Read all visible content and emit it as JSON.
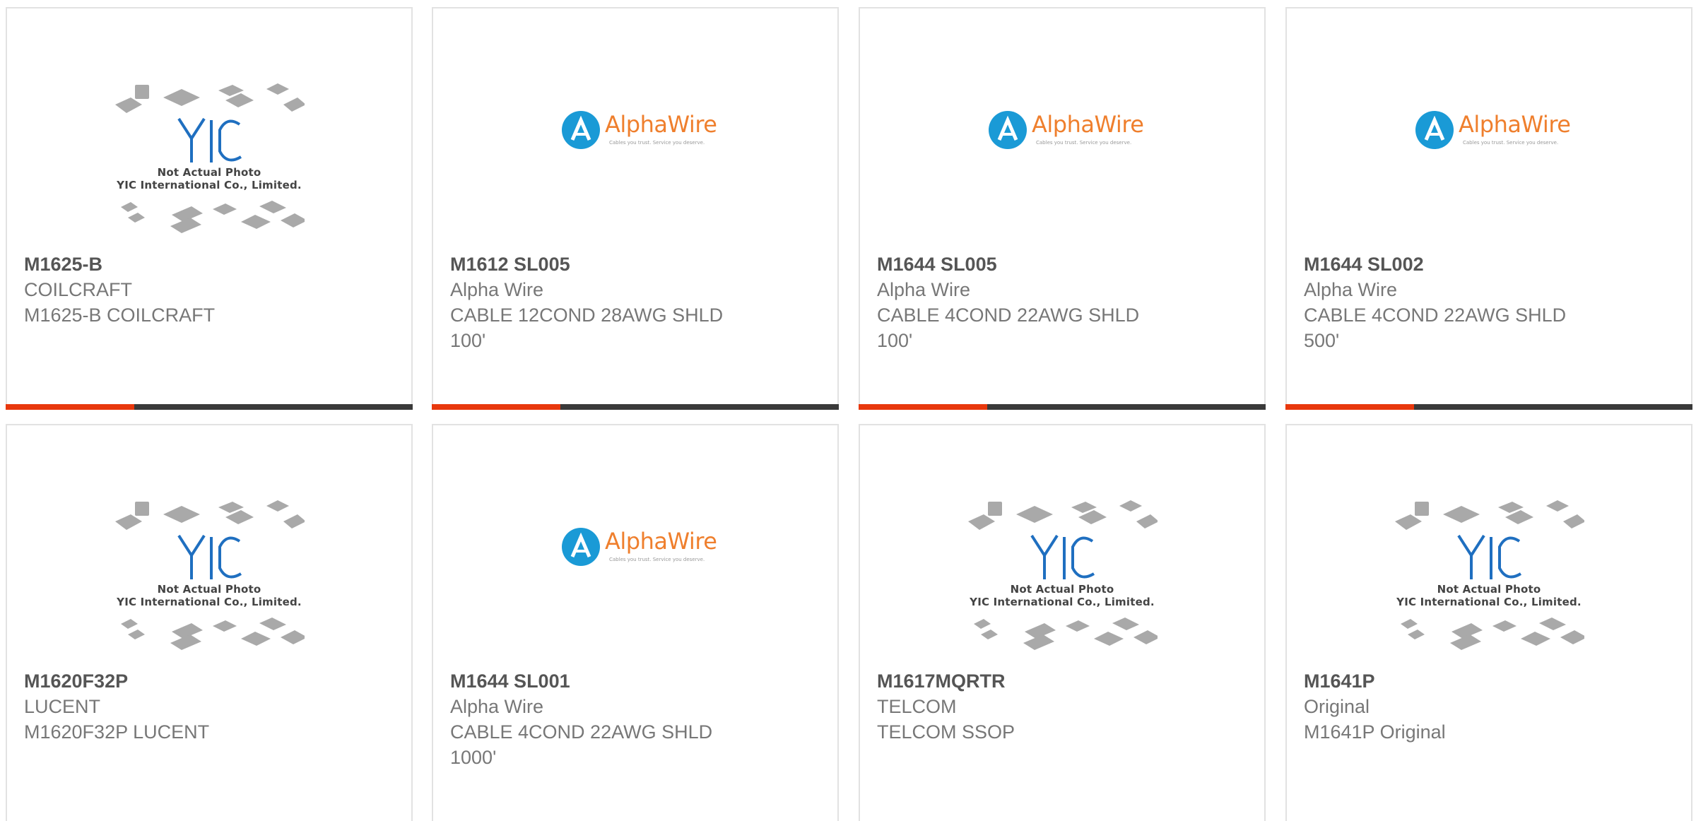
{
  "colors": {
    "accent": "#e8380d",
    "bar": "#3a3a3a",
    "alpha_blue": "#1a9ad6",
    "alpha_orange": "#ef7f2d",
    "yic_blue": "#1f6fc0"
  },
  "placeholders": {
    "yic_line1": "Not Actual Photo",
    "yic_line2": "YIC International Co., Limited.",
    "alpha_word": "AlphaWire",
    "alpha_tag": "Cables you trust. Service you deserve."
  },
  "products": [
    {
      "part": "M1625-B",
      "maker": "COILCRAFT",
      "desc1": "M1625-B COILCRAFT",
      "desc2": "",
      "image": "yic-placeholder"
    },
    {
      "part": "M1612 SL005",
      "maker": "Alpha Wire",
      "desc1": "CABLE 12COND 28AWG SHLD",
      "desc2": "100'",
      "image": "alphawire-logo"
    },
    {
      "part": "M1644 SL005",
      "maker": "Alpha Wire",
      "desc1": "CABLE 4COND 22AWG SHLD",
      "desc2": "100'",
      "image": "alphawire-logo"
    },
    {
      "part": "M1644 SL002",
      "maker": "Alpha Wire",
      "desc1": "CABLE 4COND 22AWG SHLD",
      "desc2": "500'",
      "image": "alphawire-logo"
    },
    {
      "part": "M1620F32P",
      "maker": "LUCENT",
      "desc1": "M1620F32P LUCENT",
      "desc2": "",
      "image": "yic-placeholder"
    },
    {
      "part": "M1644 SL001",
      "maker": "Alpha Wire",
      "desc1": "CABLE 4COND 22AWG SHLD",
      "desc2": "1000'",
      "image": "alphawire-logo"
    },
    {
      "part": "M1617MQRTR",
      "maker": "TELCOM",
      "desc1": "TELCOM SSOP",
      "desc2": "",
      "image": "yic-placeholder"
    },
    {
      "part": "M1641P",
      "maker": "Original",
      "desc1": "M1641P Original",
      "desc2": "",
      "image": "yic-placeholder"
    }
  ]
}
